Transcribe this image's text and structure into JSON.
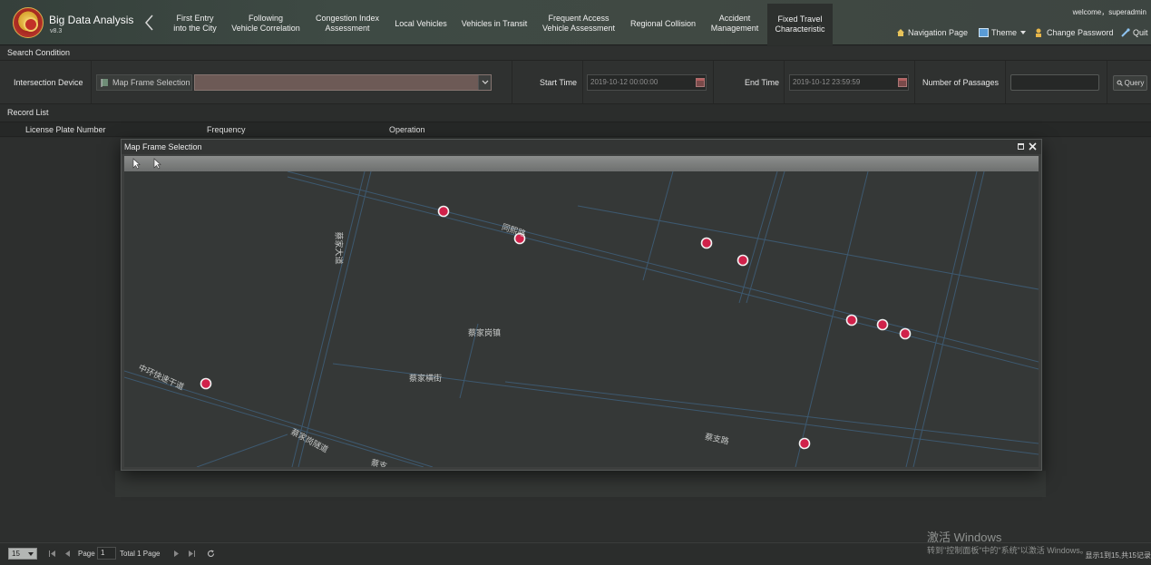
{
  "header": {
    "app_title": "Big Data Analysis",
    "app_version": "v8.3",
    "welcome": "welcome，superadmin",
    "nav_items": [
      {
        "label": "First Entry\ninto the City",
        "active": false
      },
      {
        "label": "Following\nVehicle Correlation",
        "active": false
      },
      {
        "label": "Congestion Index\nAssessment",
        "active": false
      },
      {
        "label": "Local Vehicles",
        "active": false
      },
      {
        "label": "Vehicles in Transit",
        "active": false
      },
      {
        "label": "Frequent Access\nVehicle Assessment",
        "active": false
      },
      {
        "label": "Regional Collision",
        "active": false
      },
      {
        "label": "Accident\nManagement",
        "active": false
      },
      {
        "label": "Fixed Travel\nCharacteristic",
        "active": true
      }
    ],
    "links": {
      "navigation_page": "Navigation Page",
      "theme": "Theme",
      "change_password": "Change Password",
      "quit": "Quit"
    }
  },
  "search": {
    "title": "Search Condition",
    "intersection_device_label": "Intersection Device",
    "map_frame_button": "Map Frame Selection",
    "start_time_label": "Start Time",
    "start_time_value": "2019-10-12 00:00:00",
    "end_time_label": "End Time",
    "end_time_value": "2019-10-12 23:59:59",
    "passages_label": "Number of Passages",
    "passages_value": "",
    "query_button": "Query"
  },
  "records": {
    "title": "Record List",
    "columns": [
      "License Plate Number",
      "Frequency",
      "Operation"
    ]
  },
  "map_dialog": {
    "title": "Map Frame Selection",
    "road_labels": [
      {
        "text": "同熙路",
        "rotate": 18
      },
      {
        "text": "蔡家大道",
        "rotate": 90
      },
      {
        "text": "蔡家岗镇",
        "rotate": 0
      },
      {
        "text": "蔡家横街",
        "rotate": 0
      },
      {
        "text": "中环快速干道",
        "rotate": 25
      },
      {
        "text": "蔡家岗隧道",
        "rotate": 28
      },
      {
        "text": "蔡支路",
        "rotate": 12
      },
      {
        "text": "蔡支",
        "rotate": 15
      }
    ],
    "marker_color": "#d0214a"
  },
  "pager": {
    "page_size": "15",
    "page_label": "Page",
    "page_value": "1",
    "total_label": "Total 1 Page",
    "summary": "显示1到15,共15记录"
  },
  "watermark": {
    "title": "激活 Windows",
    "subtitle": "转到\"控制面板\"中的\"系统\"以激活 Windows。"
  }
}
